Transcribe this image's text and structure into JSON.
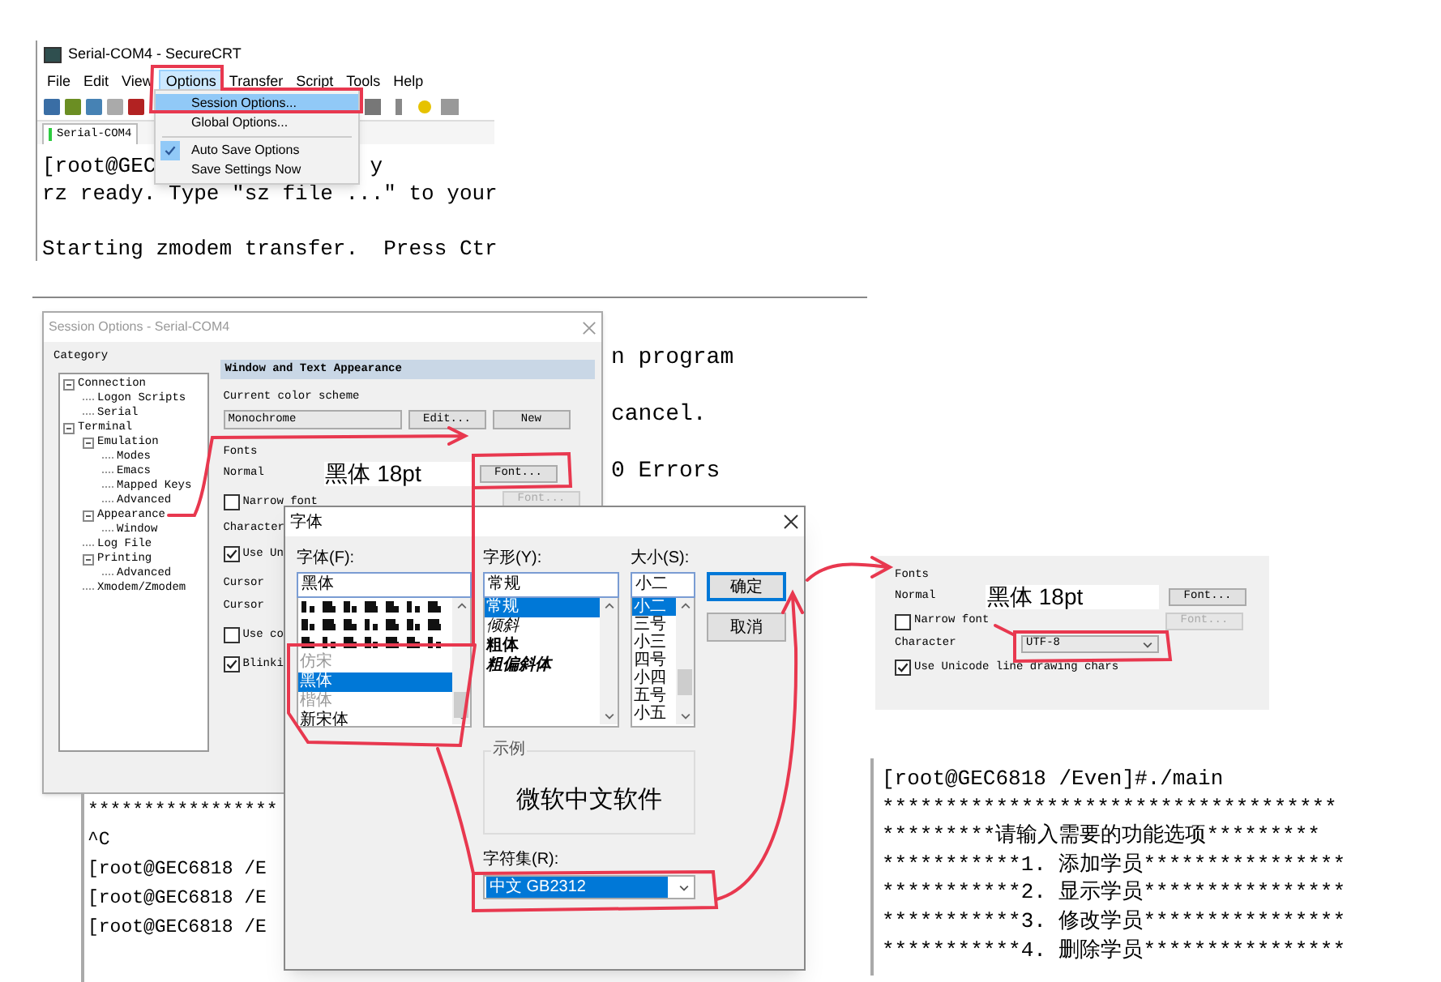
{
  "securecrt_window": {
    "title": "Serial-COM4 - SecureCRT",
    "menu": [
      {
        "label": "File",
        "selected": false
      },
      {
        "label": "Edit",
        "selected": false
      },
      {
        "label": "View",
        "selected": false
      },
      {
        "label": "Options",
        "selected": true
      },
      {
        "label": "Transfer",
        "selected": false
      },
      {
        "label": "Script",
        "selected": false
      },
      {
        "label": "Tools",
        "selected": false
      },
      {
        "label": "Help",
        "selected": false
      }
    ],
    "tab": "Serial-COM4",
    "terminal_lines": [
      {
        "text": "[root@GEC",
        "tail": "y"
      },
      {
        "text": "rz ready. Type \"sz file ...\" to your"
      },
      {
        "text": "Starting zmodem transfer.  Press Ctr"
      }
    ],
    "options_menu": [
      {
        "kind": "item",
        "label": "Session Options...",
        "selected": true,
        "checked": false
      },
      {
        "kind": "item",
        "label": "Global Options...",
        "selected": false,
        "checked": false
      },
      {
        "kind": "separator"
      },
      {
        "kind": "item",
        "label": "Auto Save Options",
        "selected": false,
        "checked": true
      },
      {
        "kind": "item",
        "label": "Save Settings Now",
        "selected": false,
        "checked": false
      }
    ]
  },
  "background_terminal": {
    "lines": [
      "n program",
      "cancel.",
      "0 Errors"
    ]
  },
  "session_options": {
    "title": "Session Options - Serial-COM4",
    "category_label": "Category",
    "tree": [
      {
        "label": "Connection",
        "expanded": true,
        "children": [
          {
            "label": "Logon Scripts"
          },
          {
            "label": "Serial"
          }
        ]
      },
      {
        "label": "Terminal",
        "expanded": true,
        "children": [
          {
            "label": "Emulation",
            "expanded": true,
            "children": [
              {
                "label": "Modes"
              },
              {
                "label": "Emacs"
              },
              {
                "label": "Mapped Keys"
              },
              {
                "label": "Advanced"
              }
            ]
          },
          {
            "label": "Appearance",
            "expanded": true,
            "children": [
              {
                "label": "Window"
              }
            ]
          },
          {
            "label": "Log File"
          },
          {
            "label": "Printing",
            "expanded": true,
            "children": [
              {
                "label": "Advanced"
              }
            ]
          },
          {
            "label": "Xmodem/Zmodem"
          }
        ]
      }
    ],
    "heading": "Window and Text Appearance",
    "color_scheme": {
      "label": "Current color scheme",
      "value": "Monochrome",
      "buttons": [
        "Edit...",
        "New"
      ]
    },
    "fonts": {
      "label": "Fonts",
      "normal_label": "Normal",
      "value": "黑体 18pt",
      "buttons": [
        {
          "label": "Font...",
          "disabled": false
        },
        {
          "label": "Font...",
          "disabled": true
        }
      ]
    },
    "narrow_font": {
      "label": "Narrow font",
      "checked": false
    },
    "character_label": "Character",
    "unicode": {
      "label": "Use Un",
      "checked": true
    },
    "cursor": {
      "label": "Cursor",
      "row_label": "Cursor",
      "checkboxes": [
        {
          "label": "Use co",
          "checked": false
        },
        {
          "label": "Blinki",
          "checked": true
        }
      ]
    }
  },
  "session_terminal": {
    "lines": [
      "*****************",
      "^C",
      "[root@GEC6818 /E",
      "[root@GEC6818 /E",
      "[root@GEC6818 /E"
    ]
  },
  "font_dialog": {
    "title": "字体",
    "font": {
      "label": "字体(F):",
      "value": "黑体",
      "items": [
        {
          "label": "仿宋",
          "selected": false,
          "dimmed": true
        },
        {
          "label": "黑体",
          "selected": true,
          "dimmed": false
        },
        {
          "label": "楷体",
          "selected": false,
          "dimmed": true
        },
        {
          "label": "新宋体",
          "selected": false,
          "dimmed": false
        }
      ]
    },
    "style": {
      "label": "字形(Y):",
      "value": "常规",
      "items": [
        {
          "label": "常规",
          "kind": "regular",
          "selected": true
        },
        {
          "label": "倾斜",
          "kind": "italic",
          "selected": false
        },
        {
          "label": "粗体",
          "kind": "bold",
          "selected": false
        },
        {
          "label": "粗偏斜体",
          "kind": "bold_italic",
          "selected": false
        }
      ]
    },
    "size": {
      "label": "大小(S):",
      "value": "小二",
      "items": [
        {
          "label": "小二",
          "selected": true
        },
        {
          "label": "三号",
          "selected": false
        },
        {
          "label": "小三",
          "selected": false
        },
        {
          "label": "四号",
          "selected": false
        },
        {
          "label": "小四",
          "selected": false
        },
        {
          "label": "五号",
          "selected": false
        },
        {
          "label": "小五",
          "selected": false
        }
      ]
    },
    "buttons": [
      {
        "label": "确定",
        "default": true
      },
      {
        "label": "取消",
        "default": false
      }
    ],
    "sample": {
      "label": "示例",
      "text": "微软中文软件"
    },
    "charset": {
      "label": "字符集(R):",
      "value": "中文 GB2312"
    }
  },
  "fonts_panel": {
    "label": "Fonts",
    "normal_label": "Normal",
    "value": "黑体 18pt",
    "buttons": [
      {
        "label": "Font...",
        "disabled": false
      },
      {
        "label": "Font...",
        "disabled": true
      }
    ],
    "narrow_font": {
      "label": "Narrow font",
      "checked": false
    },
    "character_label": "Character",
    "character_value": "UTF-8",
    "unicode": {
      "label": "Use Unicode line drawing chars",
      "checked": true
    }
  },
  "result_terminal": {
    "lines": [
      "[root@GEC6818 /Even]#./main",
      "************************************",
      "*********请输入需要的功能选项*********",
      "***********1. 添加学员****************",
      "***********2. 显示学员****************",
      "***********3. 修改学员****************",
      "***********4. 删除学员****************"
    ]
  }
}
